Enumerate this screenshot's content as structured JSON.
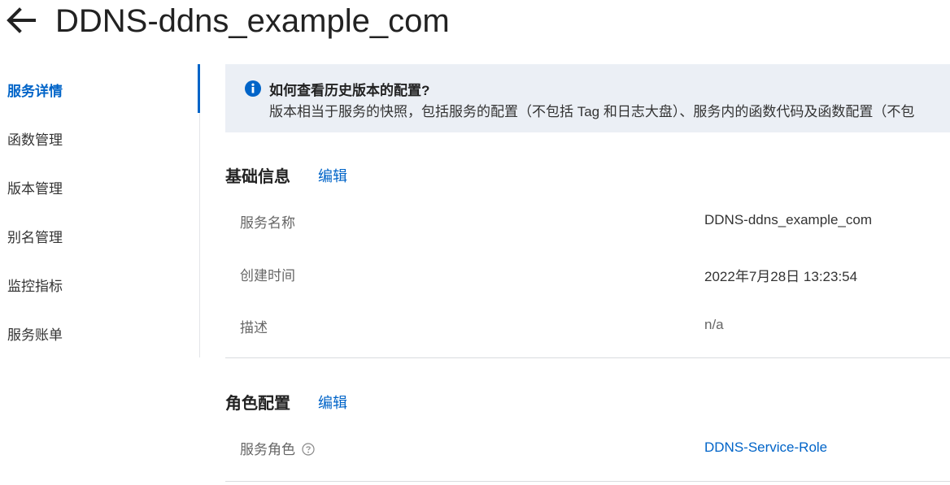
{
  "header": {
    "back_icon": "arrow-left-icon",
    "title": "DDNS-ddns_example_com"
  },
  "sidebar": {
    "items": [
      {
        "label": "服务详情",
        "active": true
      },
      {
        "label": "函数管理",
        "active": false
      },
      {
        "label": "版本管理",
        "active": false
      },
      {
        "label": "别名管理",
        "active": false
      },
      {
        "label": "监控指标",
        "active": false
      },
      {
        "label": "服务账单",
        "active": false
      }
    ]
  },
  "notice": {
    "icon": "info-icon",
    "title": "如何查看历史版本的配置?",
    "text": "版本相当于服务的快照，包括服务的配置（不包括 Tag 和日志大盘）、服务内的函数代码及函数配置（不包"
  },
  "basic_info": {
    "title": "基础信息",
    "edit_label": "编辑",
    "rows": [
      {
        "label": "服务名称",
        "value": "DDNS-ddns_example_com"
      },
      {
        "label": "创建时间",
        "value": "2022年7月28日 13:23:54"
      },
      {
        "label": "描述",
        "value": "n/a"
      }
    ]
  },
  "role_config": {
    "title": "角色配置",
    "edit_label": "编辑",
    "rows": [
      {
        "label": "服务角色",
        "value": "DDNS-Service-Role",
        "help_icon": "question-circle-icon"
      }
    ]
  },
  "colors": {
    "accent": "#0064c8",
    "notice_bg": "#ebeff5"
  }
}
